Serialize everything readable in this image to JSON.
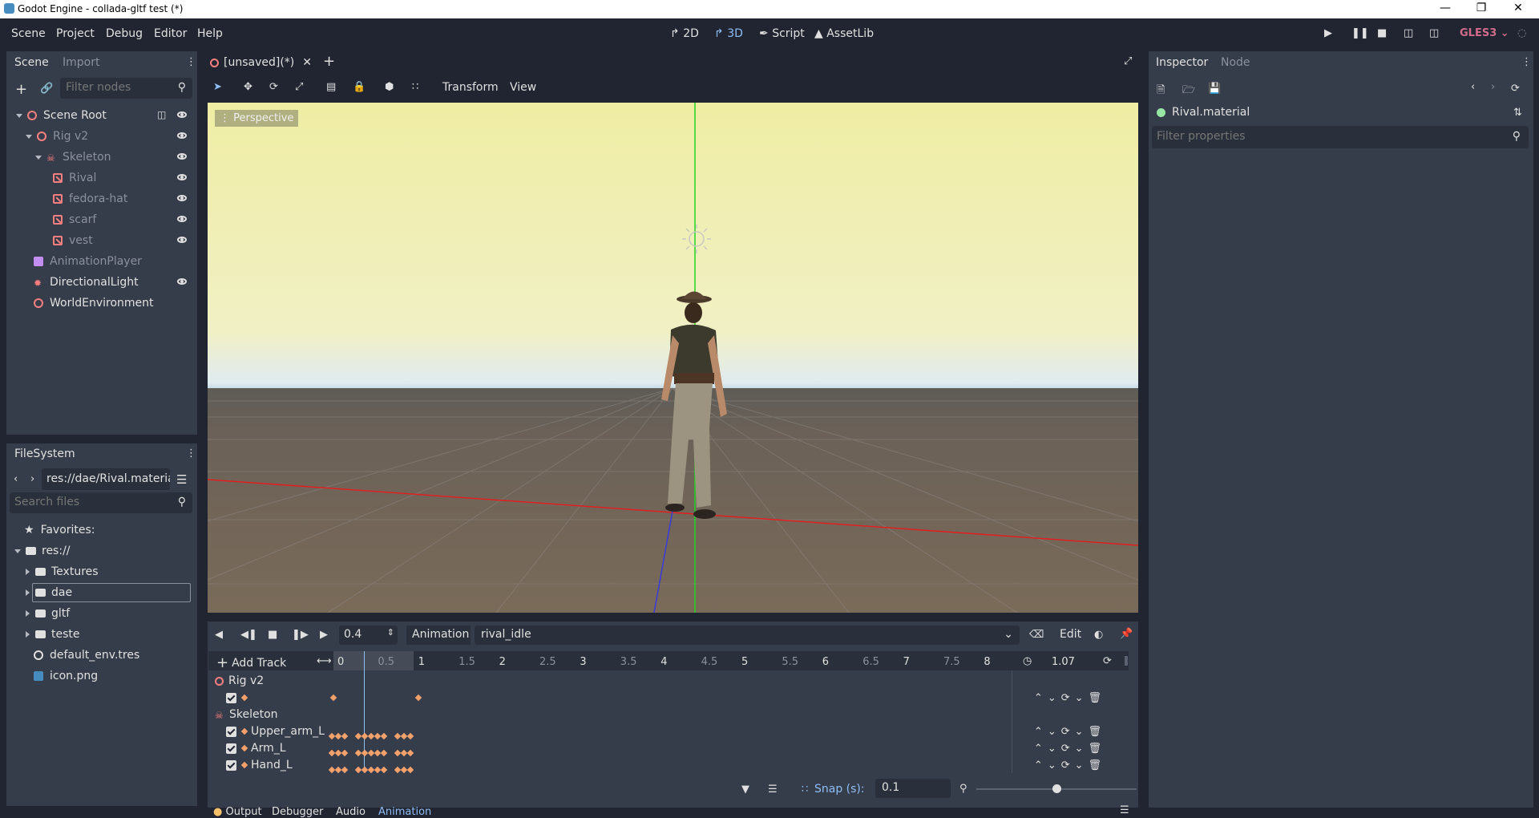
{
  "window": {
    "title": "Godot Engine - collada-gltf test (*)"
  },
  "menu": {
    "items": [
      "Scene",
      "Project",
      "Debug",
      "Editor",
      "Help"
    ]
  },
  "main_modes": {
    "2d": "2D",
    "3d": "3D",
    "script": "Script",
    "assetlib": "AssetLib"
  },
  "renderer": "GLES3",
  "scene_dock": {
    "tabs": [
      "Scene",
      "Import"
    ],
    "filter_placeholder": "Filter nodes",
    "nodes": [
      {
        "label": "Scene Root"
      },
      {
        "label": "Rig v2"
      },
      {
        "label": "Skeleton"
      },
      {
        "label": "Rival"
      },
      {
        "label": "fedora-hat"
      },
      {
        "label": "scarf"
      },
      {
        "label": "vest"
      },
      {
        "label": "AnimationPlayer"
      },
      {
        "label": "DirectionalLight"
      },
      {
        "label": "WorldEnvironment"
      }
    ]
  },
  "filesystem": {
    "tab": "FileSystem",
    "path": "res://dae/Rival.material",
    "search_placeholder": "Search files",
    "items": [
      "Favorites:",
      "res://",
      "Textures",
      "dae",
      "gltf",
      "teste",
      "default_env.tres",
      "icon.png"
    ]
  },
  "editor_tab": {
    "label": "[unsaved](*)"
  },
  "viewport_toolbar": {
    "transform": "Transform",
    "view": "View"
  },
  "viewport": {
    "perspective_label": "Perspective"
  },
  "animation": {
    "time": "0.4",
    "label": "Animation",
    "current": "rival_idle",
    "edit": "Edit",
    "add_track": "Add Track",
    "length": "1.07",
    "ruler": [
      "0",
      "0.5",
      "1",
      "1.5",
      "2",
      "2.5",
      "3",
      "3.5",
      "4",
      "4.5",
      "5",
      "5.5",
      "6",
      "6.5",
      "7",
      "7.5",
      "8"
    ],
    "groups": [
      {
        "name": "Rig v2",
        "tracks": [
          ""
        ]
      },
      {
        "name": "Skeleton",
        "tracks": [
          "Upper_arm_L",
          "Arm_L",
          "Hand_L"
        ]
      }
    ],
    "snap_label": "Snap (s):",
    "snap_value": "0.1"
  },
  "bottom_tabs": [
    "Output",
    "Debugger",
    "Audio",
    "Animation"
  ],
  "inspector": {
    "tabs": [
      "Inspector",
      "Node"
    ],
    "resource": "Rival.material",
    "filter_placeholder": "Filter properties"
  },
  "colors": {
    "background": "#202531",
    "panel": "#363d4a",
    "accent": "#8fbdf5",
    "node_red": "#fc7f7f",
    "keyframe": "#f2a16b"
  }
}
